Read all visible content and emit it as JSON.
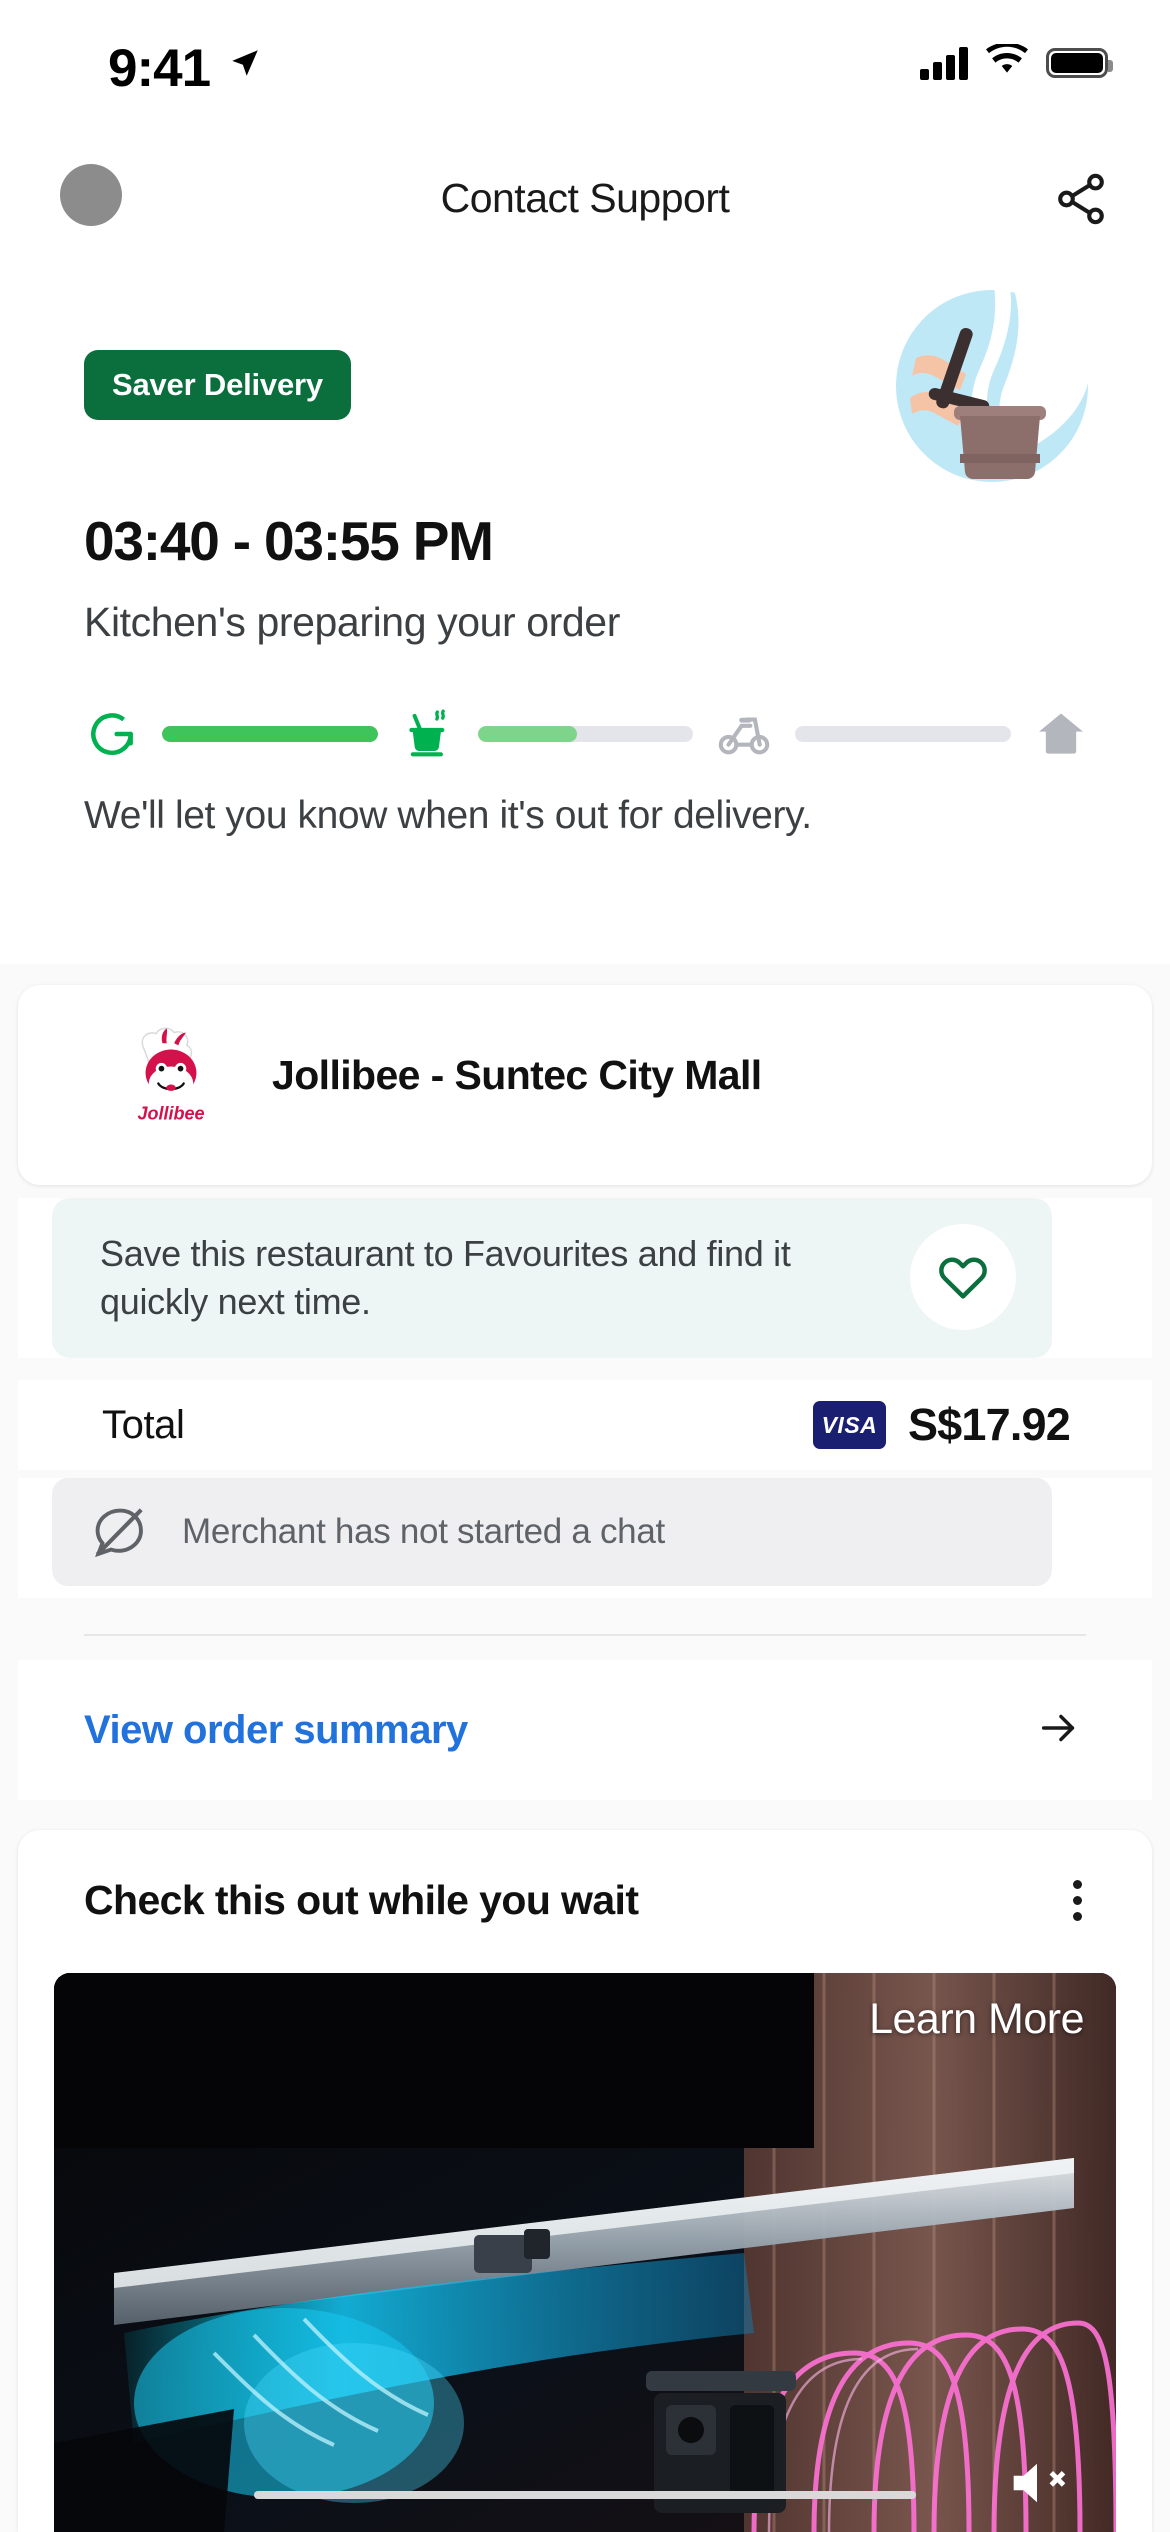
{
  "status_bar": {
    "time": "9:41",
    "location_icon": "location-arrow-icon",
    "cellular_icon": "cellular-signal-icon",
    "wifi_icon": "wifi-icon",
    "battery_icon": "battery-full-icon"
  },
  "nav": {
    "back_icon": "back-circle-icon",
    "title": "Contact Support",
    "share_icon": "share-icon"
  },
  "hero": {
    "badge": "Saver Delivery",
    "eta": "03:40 - 03:55 PM",
    "status": "Kitchen's preparing your order",
    "notice": "We'll let you know when it's out for delivery.",
    "illustration_icon": "cooking-pot-illustration",
    "tracker": {
      "steps": [
        {
          "icon": "grab-g-logo-icon",
          "state": "done"
        },
        {
          "icon": "cooking-pot-icon",
          "state": "active"
        },
        {
          "icon": "scooter-icon",
          "state": "pending"
        },
        {
          "icon": "home-icon",
          "state": "pending"
        }
      ],
      "segments": [
        {
          "fill_percent": 100
        },
        {
          "fill_percent": 46
        },
        {
          "fill_percent": 0
        }
      ],
      "colors": {
        "done": "#3FC35B",
        "active": "#7ED48B",
        "track": "#E3E5EA",
        "icon_done": "#00B14F",
        "icon_pending": "#B3B6BD"
      }
    }
  },
  "order_card": {
    "merchant_logo_icon": "jollibee-logo-icon",
    "merchant_name": "Jollibee - Suntec City Mall",
    "favourites": {
      "text": "Save this restaurant to Favourites and find it quickly next time.",
      "heart_icon": "heart-outline-icon",
      "background": "#EEF6F5",
      "heart_color": "#0B6E3D"
    },
    "total_label": "Total",
    "payment_method_icon": "visa-card-icon",
    "payment_method_label": "VISA",
    "total_amount": "S$17.92",
    "chat": {
      "icon": "chat-disabled-icon",
      "message": "Merchant has not started a chat"
    },
    "summary_link": "View order summary",
    "summary_arrow_icon": "arrow-right-icon",
    "link_color": "#2272DE"
  },
  "ad_card": {
    "title": "Check this out while you wait",
    "kebab_icon": "more-options-icon",
    "cta": "Learn More",
    "mute_icon": "speaker-muted-icon",
    "media_icon": "video-thumbnail"
  }
}
